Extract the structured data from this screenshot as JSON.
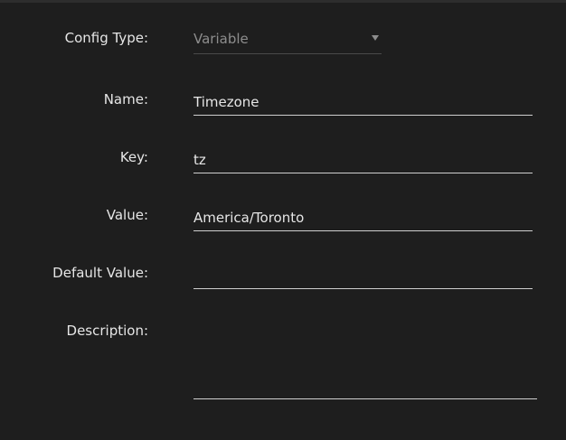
{
  "form": {
    "config_type": {
      "label": "Config Type:",
      "value": "Variable",
      "icon": "chevron-down-icon"
    },
    "name": {
      "label": "Name:",
      "value": "Timezone"
    },
    "key": {
      "label": "Key:",
      "value": "tz"
    },
    "value": {
      "label": "Value:",
      "value": "America/Toronto"
    },
    "default_value": {
      "label": "Default Value:",
      "value": ""
    },
    "description": {
      "label": "Description:",
      "value": ""
    }
  },
  "colors": {
    "background": "#1e1e1e",
    "text": "#e6e6e6",
    "muted_text": "#8d8d8d",
    "underline": "#cfcfcf"
  }
}
